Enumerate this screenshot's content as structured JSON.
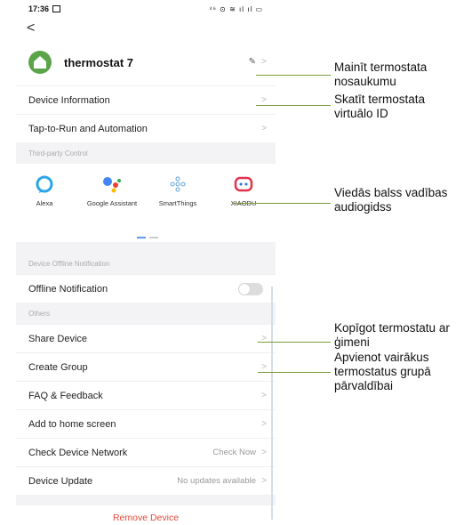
{
  "status": {
    "time": "17:36",
    "icons": "⁴⁶ ⊙ ≋ ıl ıl ▭"
  },
  "nav": {
    "back": "<"
  },
  "device": {
    "name": "thermostat 7"
  },
  "rows": {
    "device_info": "Device Information",
    "tap_to_run": "Tap-to-Run and Automation",
    "offline_notification": "Offline Notification",
    "share": "Share Device",
    "create_group": "Create Group",
    "faq": "FAQ & Feedback",
    "home_screen": "Add to home screen",
    "check_network": "Check Device Network",
    "check_network_value": "Check Now",
    "device_update": "Device Update",
    "device_update_value": "No updates available"
  },
  "sections": {
    "third_party": "Third-party Control",
    "offline": "Device Offline Notification",
    "others": "Others"
  },
  "third_party": [
    {
      "label": "Alexa",
      "icon": "alexa-icon"
    },
    {
      "label": "Google Assistant",
      "icon": "google-assistant-icon"
    },
    {
      "label": "SmartThings",
      "icon": "smartthings-icon"
    },
    {
      "label": "XIAODU",
      "icon": "xiaodu-icon"
    }
  ],
  "remove": "Remove Device",
  "offline_toggle": false,
  "callouts": {
    "c1": "Mainīt termostata nosaukumu",
    "c2": "Skatīt termostata virtuālo ID",
    "c3": "Viedās balss vadības audiogidss",
    "c4": "Kopīgot termostatu ar ģimeni",
    "c5": "Apvienot vairākus termostatus grupā pārvaldībai"
  },
  "colors": {
    "accent": "#5b9bf5",
    "danger": "#e24a3b",
    "brand_green": "#5ba44a",
    "callout_line": "#7a9d3a"
  }
}
